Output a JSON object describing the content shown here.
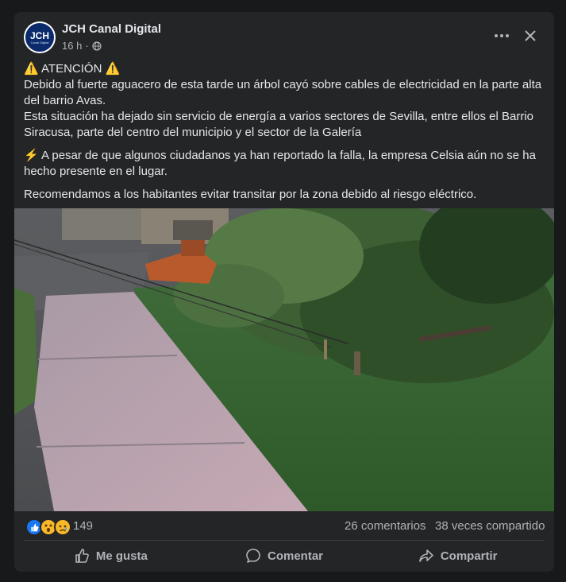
{
  "post": {
    "page_name": "JCH Canal Digital",
    "avatar_text": "JCH",
    "avatar_subtext": "Canal Digital",
    "time": "16 h",
    "separator": "·",
    "paragraphs": {
      "heading": "⚠️ ATENCIÓN ⚠️",
      "p1": "Debido al fuerte aguacero de esta tarde un árbol cayó sobre cables de electricidad en la parte alta del barrio Avas.",
      "p2": "Esta situación ha dejado sin servicio de energía a varios sectores de Sevilla, entre ellos el Barrio Siracusa, parte del centro del municipio y el sector de la Galería",
      "p3": "⚡ A pesar de que algunos ciudadanos ya han reportado la falla, la empresa Celsia aún no se ha hecho presente en el lugar.",
      "p4": "Recomendamos a los habitantes evitar transitar por la zona debido al riesgo eléctrico."
    }
  },
  "stats": {
    "reactions_count": "149",
    "comments": "26 comentarios",
    "shares": "38 veces compartido"
  },
  "actions": {
    "like": "Me gusta",
    "comment": "Comentar",
    "share": "Compartir"
  },
  "colors": {
    "background": "#18191a",
    "card": "#242526",
    "text": "#e4e6eb",
    "secondary_text": "#b0b3b8",
    "like_blue": "#1877f2",
    "care_yellow": "#f7b928"
  },
  "icons": {
    "globe": "globe-icon",
    "more": "more-icon",
    "close": "close-icon",
    "like": "thumbs-up-icon",
    "comment": "comment-icon",
    "share": "share-icon"
  }
}
